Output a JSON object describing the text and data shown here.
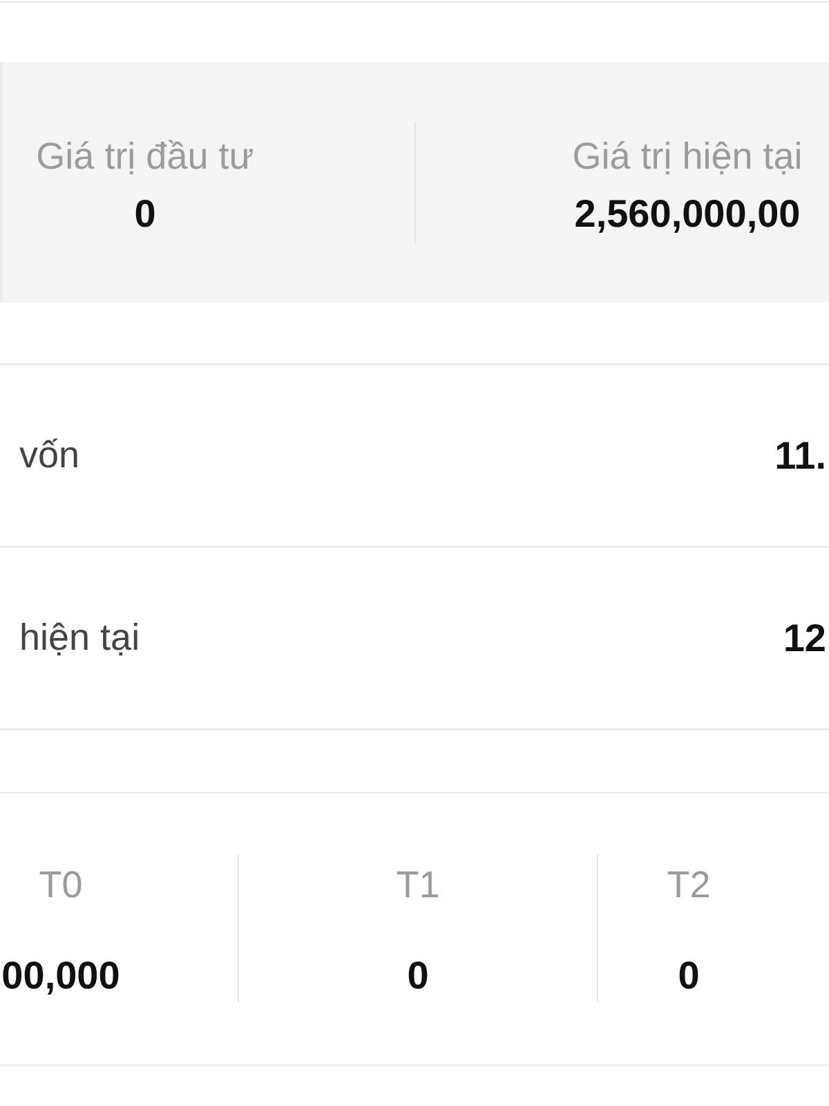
{
  "summary": {
    "items": [
      {
        "label": "Giá trị đầu tư",
        "value": "0"
      },
      {
        "label": "Giá trị hiện tại",
        "value": "2,560,000,00"
      }
    ]
  },
  "metrics": [
    {
      "label": "vốn",
      "value": "11."
    },
    {
      "label": "hiện tại",
      "value": "12"
    }
  ],
  "sessions": [
    {
      "label": "T0",
      "value": "00,000"
    },
    {
      "label": "T1",
      "value": "0"
    },
    {
      "label": "T2",
      "value": "0"
    }
  ]
}
